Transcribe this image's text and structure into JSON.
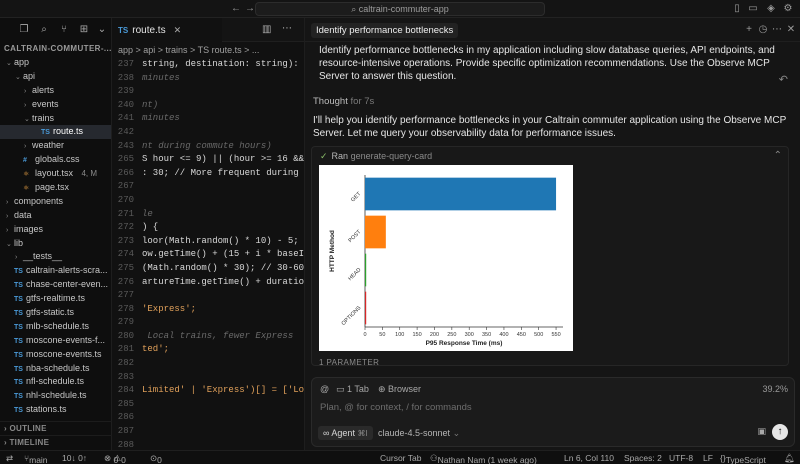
{
  "window": {
    "search_text": "caltrain-commuter-app"
  },
  "sidebar": {
    "explorer_title": "CALTRAIN-COMMUTER-...",
    "items": [
      {
        "label": "app",
        "indent": 0,
        "type": "folder",
        "expanded": true
      },
      {
        "label": "api",
        "indent": 1,
        "type": "folder",
        "expanded": true
      },
      {
        "label": "alerts",
        "indent": 2,
        "type": "folder",
        "expanded": false
      },
      {
        "label": "events",
        "indent": 2,
        "type": "folder",
        "expanded": false
      },
      {
        "label": "trains",
        "indent": 2,
        "type": "folder",
        "expanded": true
      },
      {
        "label": "route.ts",
        "indent": 3,
        "type": "ts",
        "active": true
      },
      {
        "label": "weather",
        "indent": 2,
        "type": "folder",
        "expanded": false
      },
      {
        "label": "globals.css",
        "indent": 1,
        "type": "css"
      },
      {
        "label": "layout.tsx",
        "indent": 1,
        "type": "tsx",
        "badge": "4, M"
      },
      {
        "label": "page.tsx",
        "indent": 1,
        "type": "tsx"
      },
      {
        "label": "components",
        "indent": 0,
        "type": "folder",
        "expanded": false
      },
      {
        "label": "data",
        "indent": 0,
        "type": "folder",
        "expanded": false
      },
      {
        "label": "images",
        "indent": 0,
        "type": "folder",
        "expanded": false
      },
      {
        "label": "lib",
        "indent": 0,
        "type": "folder",
        "expanded": true
      },
      {
        "label": "__tests__",
        "indent": 1,
        "type": "folder",
        "expanded": false
      },
      {
        "label": "caltrain-alerts-scra...",
        "indent": 0,
        "type": "ts"
      },
      {
        "label": "chase-center-even...",
        "indent": 0,
        "type": "ts"
      },
      {
        "label": "gtfs-realtime.ts",
        "indent": 0,
        "type": "ts"
      },
      {
        "label": "gtfs-static.ts",
        "indent": 0,
        "type": "ts"
      },
      {
        "label": "mlb-schedule.ts",
        "indent": 0,
        "type": "ts"
      },
      {
        "label": "moscone-events-f...",
        "indent": 0,
        "type": "ts"
      },
      {
        "label": "moscone-events.ts",
        "indent": 0,
        "type": "ts"
      },
      {
        "label": "nba-schedule.ts",
        "indent": 0,
        "type": "ts"
      },
      {
        "label": "nfl-schedule.ts",
        "indent": 0,
        "type": "ts"
      },
      {
        "label": "nhl-schedule.ts",
        "indent": 0,
        "type": "ts"
      },
      {
        "label": "stations.ts",
        "indent": 0,
        "type": "ts"
      }
    ],
    "outline_label": "OUTLINE",
    "timeline_label": "TIMELINE"
  },
  "editor": {
    "tab_label": "route.ts",
    "tab_type": "TS",
    "breadcrumb": "app > api > trains > TS route.ts > ...",
    "lines": [
      {
        "n": "237",
        "text": "string, destination: string): T",
        "cls": "code"
      },
      {
        "n": "238",
        "text": "minutes",
        "cls": "cmt"
      },
      {
        "n": "239",
        "text": "",
        "cls": "code"
      },
      {
        "n": "240",
        "text": "nt)",
        "cls": "cmt"
      },
      {
        "n": "241",
        "text": "minutes",
        "cls": "cmt"
      },
      {
        "n": "242",
        "text": "",
        "cls": "code"
      },
      {
        "n": "243",
        "text": "nt during commute hours)",
        "cls": "cmt"
      },
      {
        "n": "265",
        "text": "S hour <= 9) || (hour >= 16 && ho",
        "cls": "code"
      },
      {
        "n": "266",
        "text": ": 30; // More frequent during pea",
        "cls": "code"
      },
      {
        "n": "267",
        "text": "",
        "cls": "code"
      },
      {
        "n": "270",
        "text": "",
        "cls": "code"
      },
      {
        "n": "271",
        "text": "le",
        "cls": "cmt"
      },
      {
        "n": "272",
        "text": ") {",
        "cls": "code"
      },
      {
        "n": "273",
        "text": "loor(Math.random() * 10) - 5; //",
        "cls": "code"
      },
      {
        "n": "274",
        "text": "ow.getTime() + (15 + i * baseInte",
        "cls": "code"
      },
      {
        "n": "275",
        "text": "(Math.random() * 30); // 30-60 mi",
        "cls": "code"
      },
      {
        "n": "276",
        "text": "artureTime.getTime() + duration *",
        "cls": "code"
      },
      {
        "n": "277",
        "text": "",
        "cls": "code"
      },
      {
        "n": "278",
        "text": "'Express';",
        "cls": "str"
      },
      {
        "n": "279",
        "text": "",
        "cls": "code"
      },
      {
        "n": "280",
        "text": " Local trains, fewer Express",
        "cls": "cmt"
      },
      {
        "n": "281",
        "text": "ted';",
        "cls": "str"
      },
      {
        "n": "282",
        "text": "",
        "cls": "code"
      },
      {
        "n": "283",
        "text": "",
        "cls": "code"
      },
      {
        "n": "284",
        "text": "Limited' | 'Express')[] = ['Local",
        "cls": "str"
      },
      {
        "n": "285",
        "text": "",
        "cls": "code"
      },
      {
        "n": "286",
        "text": "",
        "cls": "code"
      },
      {
        "n": "287",
        "text": "",
        "cls": "code"
      },
      {
        "n": "288",
        "text": "",
        "cls": "code"
      },
      {
        "n": "289",
        "text": "",
        "cls": "code"
      }
    ]
  },
  "chat": {
    "title": "Identify performance bottlenecks",
    "prompt": "Identify performance bottlenecks in my application including slow database queries, API endpoints, and resource-intensive operations. Provide specific optimization recommendations. Use the Observe MCP Server to answer this question.",
    "thought_label": "Thought",
    "thought_time": "for 7s",
    "reply": "I'll help you identify performance bottlenecks in your Caltrain commuter application using the Observe MCP Server. Let me query your observability data for performance issues.",
    "tool_status": "Ran",
    "tool_name": "generate-query-card",
    "param_label": "1 PARAMETER"
  },
  "chart_data": {
    "type": "bar",
    "orientation": "horizontal",
    "categories": [
      "GET",
      "POST",
      "HEAD",
      "OPTIONS"
    ],
    "values": [
      550,
      60,
      3,
      2
    ],
    "colors": [
      "#1f77b4",
      "#ff7f0e",
      "#2ca02c",
      "#d62728"
    ],
    "xlabel": "P95 Response Time (ms)",
    "ylabel": "HTTP Method",
    "xticks": [
      0,
      50,
      100,
      150,
      200,
      250,
      300,
      350,
      400,
      450,
      500,
      550
    ],
    "xlim": [
      0,
      570
    ],
    "category_labels": [
      "GET",
      "POST",
      "HEAD",
      "OPTIONS"
    ]
  },
  "composer": {
    "tab_chip": "1 Tab",
    "browser_chip": "Browser",
    "percent": "39.2%",
    "placeholder": "Plan, @ for context, / for commands",
    "agent_label": "Agent",
    "agent_shortcut": "⌘I",
    "model": "claude-4.5-sonnet"
  },
  "statusbar": {
    "branch": "main",
    "sync": "10↓ 0↑",
    "errors": "0",
    "warnings": "0",
    "ports": "0",
    "cursor_tab": "Cursor Tab",
    "blame": "Nathan Nam (1 week ago)",
    "position": "Ln 6, Col 110",
    "spaces": "Spaces: 2",
    "encoding": "UTF-8",
    "eol": "LF",
    "language": "TypeScript"
  }
}
